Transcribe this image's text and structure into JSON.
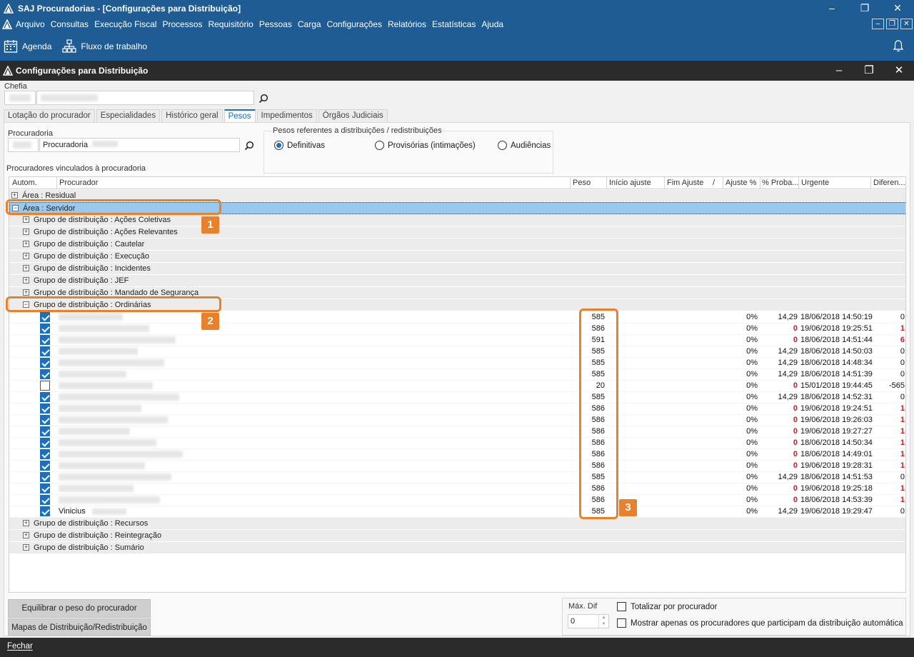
{
  "app": {
    "title": "SAJ Procuradorias - [Configurações para Distribuição]",
    "menu": [
      "Arquivo",
      "Consultas",
      "Execução Fiscal",
      "Processos",
      "Requisitório",
      "Pessoas",
      "Carga",
      "Configurações",
      "Relatórios",
      "Estatísticas",
      "Ajuda"
    ],
    "toolbar": {
      "agenda": "Agenda",
      "workflow": "Fluxo de trabalho"
    }
  },
  "window": {
    "title": "Configurações para Distribuição",
    "chefia_label": "Chefia",
    "tabs": [
      "Lotação do procurador",
      "Especialidades",
      "Histórico geral",
      "Pesos",
      "Impedimentos",
      "Órgãos Judiciais"
    ],
    "active_tab": "Pesos",
    "procuradoria_label": "Procuradoria",
    "procuradoria_value": "Procuradoria",
    "weights_group_label": "Pesos referentes a distribuições / redistribuições",
    "radios": [
      "Definitivas",
      "Provisórias (intimações)",
      "Audiências"
    ],
    "selected_radio": "Definitivas",
    "grid_label": "Procuradores vinculados à procuradoria"
  },
  "grid": {
    "columns": [
      "Autom.",
      "Procurador",
      "Peso",
      "Início ajuste",
      "Fim Ajuste",
      "/",
      "Ajuste %",
      "% Proba...",
      "Urgente",
      "Diferen..."
    ],
    "groups_top": [
      {
        "label": "Área : Residual",
        "expanded": false,
        "level": 0
      },
      {
        "label": "Área : Servidor",
        "expanded": true,
        "level": 0,
        "selected": true
      },
      {
        "label": "Grupo de distribuição : Ações Coletivas",
        "expanded": false,
        "level": 1
      },
      {
        "label": "Grupo de distribuição : Ações Relevantes",
        "expanded": false,
        "level": 1
      },
      {
        "label": "Grupo de distribuição : Cautelar",
        "expanded": false,
        "level": 1
      },
      {
        "label": "Grupo de distribuição : Execução",
        "expanded": false,
        "level": 1
      },
      {
        "label": "Grupo de distribuição : Incidentes",
        "expanded": false,
        "level": 1
      },
      {
        "label": "Grupo de distribuição : JEF",
        "expanded": false,
        "level": 1
      },
      {
        "label": "Grupo de distribuição : Mandado de Segurança",
        "expanded": false,
        "level": 1
      },
      {
        "label": "Grupo de distribuição : Ordinárias",
        "expanded": true,
        "level": 1
      }
    ],
    "rows": [
      {
        "auto": true,
        "name": "",
        "peso": "585",
        "ajuste": "0%",
        "proba": "14,29",
        "urgente": "18/06/2018 14:50:19",
        "dif": "0"
      },
      {
        "auto": true,
        "name": "",
        "peso": "586",
        "ajuste": "0%",
        "proba": "0",
        "urgente": "19/06/2018 19:25:51",
        "dif": "1"
      },
      {
        "auto": true,
        "name": "",
        "peso": "591",
        "ajuste": "0%",
        "proba": "0",
        "urgente": "18/06/2018 14:51:44",
        "dif": "6"
      },
      {
        "auto": true,
        "name": "",
        "peso": "585",
        "ajuste": "0%",
        "proba": "14,29",
        "urgente": "18/06/2018 14:50:03",
        "dif": "0"
      },
      {
        "auto": true,
        "name": "",
        "peso": "585",
        "ajuste": "0%",
        "proba": "14,29",
        "urgente": "18/06/2018 14:48:34",
        "dif": "0"
      },
      {
        "auto": true,
        "name": "",
        "peso": "585",
        "ajuste": "0%",
        "proba": "14,29",
        "urgente": "18/06/2018 14:51:39",
        "dif": "0"
      },
      {
        "auto": false,
        "name": "",
        "peso": "20",
        "ajuste": "0%",
        "proba": "0",
        "urgente": "15/01/2018 19:44:45",
        "dif": "-565"
      },
      {
        "auto": true,
        "name": "",
        "peso": "585",
        "ajuste": "0%",
        "proba": "14,29",
        "urgente": "18/06/2018 14:52:31",
        "dif": "0"
      },
      {
        "auto": true,
        "name": "",
        "peso": "586",
        "ajuste": "0%",
        "proba": "0",
        "urgente": "19/06/2018 19:24:51",
        "dif": "1"
      },
      {
        "auto": true,
        "name": "",
        "peso": "586",
        "ajuste": "0%",
        "proba": "0",
        "urgente": "19/06/2018 19:26:03",
        "dif": "1"
      },
      {
        "auto": true,
        "name": "",
        "peso": "586",
        "ajuste": "0%",
        "proba": "0",
        "urgente": "19/06/2018 19:27:27",
        "dif": "1"
      },
      {
        "auto": true,
        "name": "",
        "peso": "586",
        "ajuste": "0%",
        "proba": "0",
        "urgente": "18/06/2018 14:50:34",
        "dif": "1"
      },
      {
        "auto": true,
        "name": "",
        "peso": "586",
        "ajuste": "0%",
        "proba": "0",
        "urgente": "18/06/2018 14:49:01",
        "dif": "1"
      },
      {
        "auto": true,
        "name": "",
        "peso": "586",
        "ajuste": "0%",
        "proba": "0",
        "urgente": "19/06/2018 19:28:31",
        "dif": "1"
      },
      {
        "auto": true,
        "name": "",
        "peso": "585",
        "ajuste": "0%",
        "proba": "14,29",
        "urgente": "18/06/2018 14:51:53",
        "dif": "0"
      },
      {
        "auto": true,
        "name": "",
        "peso": "586",
        "ajuste": "0%",
        "proba": "0",
        "urgente": "19/06/2018 19:25:18",
        "dif": "1"
      },
      {
        "auto": true,
        "name": "",
        "peso": "586",
        "ajuste": "0%",
        "proba": "0",
        "urgente": "18/06/2018 14:53:39",
        "dif": "1"
      },
      {
        "auto": true,
        "name": "Vinicius",
        "peso": "585",
        "ajuste": "0%",
        "proba": "14,29",
        "urgente": "19/06/2018 19:29:47",
        "dif": "0"
      }
    ],
    "groups_bottom": [
      {
        "label": "Grupo de distribuição : Recursos",
        "expanded": false,
        "level": 1
      },
      {
        "label": "Grupo de distribuição : Reintegração",
        "expanded": false,
        "level": 1
      },
      {
        "label": "Grupo de distribuição : Sumário",
        "expanded": false,
        "level": 1
      }
    ]
  },
  "callouts": [
    "1",
    "2",
    "3"
  ],
  "bottom": {
    "btn_equilibrar": "Equilibrar o peso do procurador",
    "btn_mapas": "Mapas de Distribuição/Redistribuição",
    "max_dif_label": "Máx. Dif",
    "max_dif_value": "0",
    "chk_totalizar": "Totalizar por procurador",
    "chk_mostrar": "Mostrar apenas os procuradores que participam da distribuição automática",
    "close": "Fechar"
  },
  "colors": {
    "titlebar": "#1e5c93",
    "window_title": "#2b2b2b",
    "accent": "#1a6fbf",
    "callout": "#e9802b",
    "negative": "#c0202a"
  }
}
